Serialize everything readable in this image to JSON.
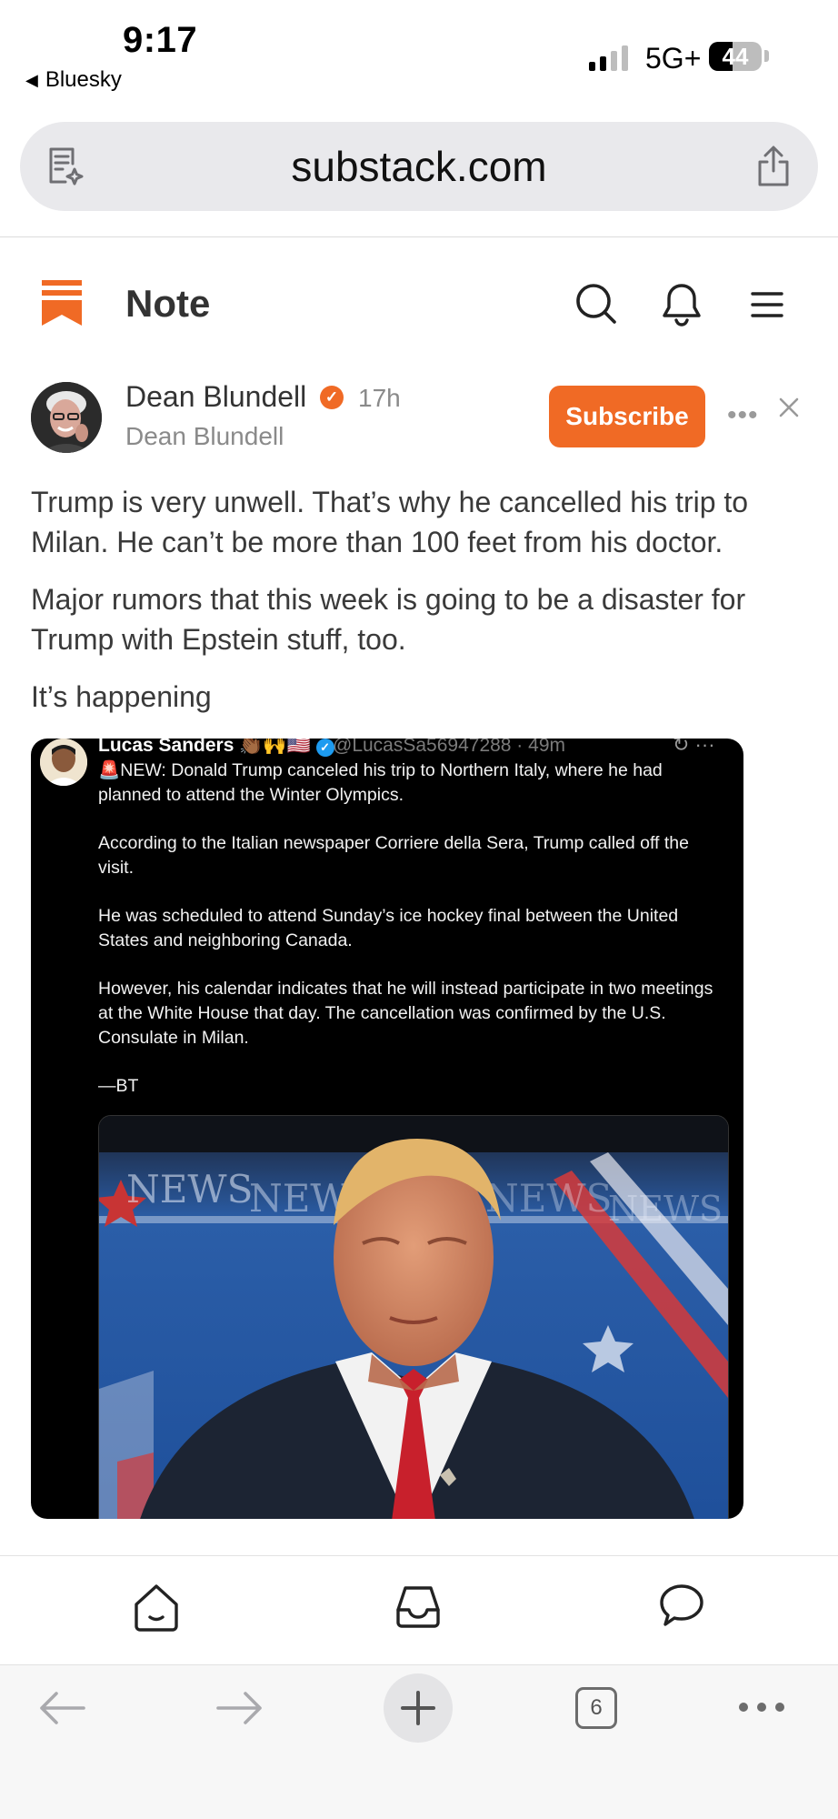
{
  "status_bar": {
    "time": "9:17",
    "back_label": "Bluesky",
    "network": "5G+",
    "battery": "44",
    "battery_level": 0.44
  },
  "browser": {
    "url": "substack.com",
    "tab_count": "6"
  },
  "header": {
    "title": "Note",
    "accent_color": "#f06a25"
  },
  "author": {
    "name": "Dean Blundell",
    "handle": "Dean Blundell",
    "time_ago": "17h",
    "subscribe_label": "Subscribe"
  },
  "post": {
    "paragraphs": [
      "Trump is very unwell. That’s why he cancelled his trip to Milan. He can’t be more than 100 feet from his doctor.",
      "Major rumors that this week is going to be a disaster for Trump with Epstein stuff, too.",
      "It’s happening"
    ]
  },
  "embed": {
    "author": "Lucas Sanders",
    "handle": "@LucasSa56947288 · 49m",
    "paragraphs": [
      "🚨NEW: Donald Trump canceled his trip to Northern Italy, where he had planned to attend the Winter Olympics.",
      "According to the Italian newspaper Corriere della Sera, Trump called off the visit.",
      "He was scheduled to attend Sunday’s ice hockey final between the United States and neighboring Canada.",
      "However, his calendar indicates that he will instead participate in two meetings at the White House that day. The cancellation was confirmed by the U.S. Consulate in Milan.",
      "—BT"
    ],
    "backdrop_text": [
      "NEWS",
      "NEWS",
      "NEWS",
      "NEWS"
    ]
  }
}
